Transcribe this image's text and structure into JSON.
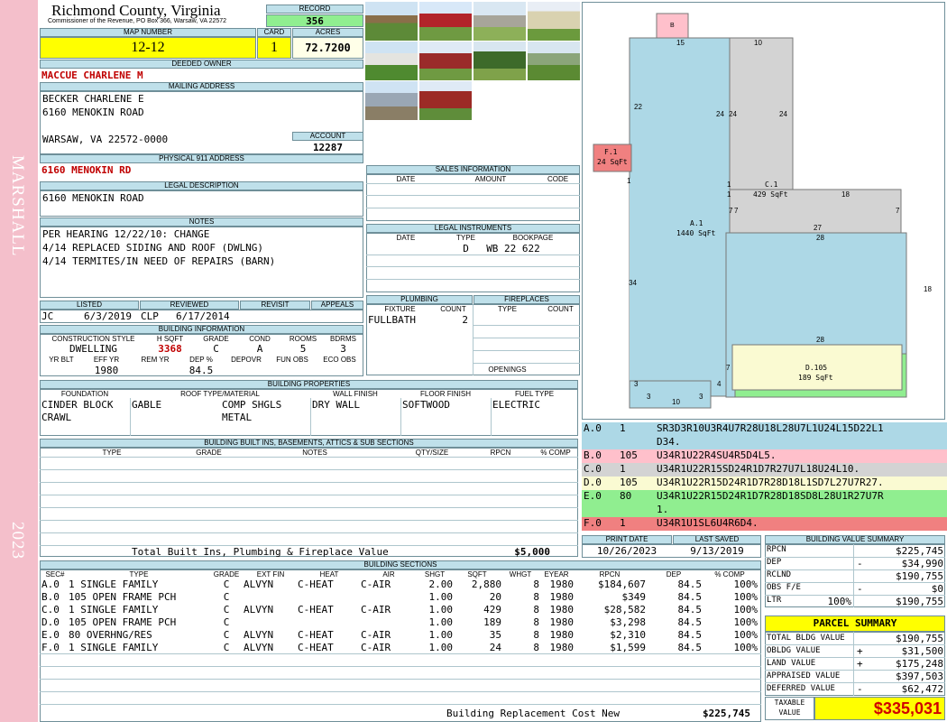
{
  "side": {
    "district": "MARSHALL",
    "year": "2023"
  },
  "header": {
    "county": "Richmond County, Virginia",
    "commissioner": "Commissioner of the Revenue, PO Box 366, Warsaw, VA 22572",
    "record_label": "RECORD",
    "record": "356",
    "map_label": "MAP NUMBER",
    "map": "12-12",
    "card_label": "CARD",
    "card": "1",
    "acres_label": "ACRES",
    "acres": "72.7200"
  },
  "owner": {
    "deeded_label": "DEEDED OWNER",
    "deeded": "MACCUE CHARLENE M",
    "mailing_label": "MAILING ADDRESS",
    "mail1": "BECKER CHARLENE E",
    "mail2": "6160 MENOKIN ROAD",
    "mail3": "WARSAW, VA 22572-0000",
    "account_label": "ACCOUNT",
    "account": "12287",
    "physical_label": "PHYSICAL 911 ADDRESS",
    "physical": "6160 MENOKIN RD",
    "legal_label": "LEGAL DESCRIPTION",
    "legal": "6160 MENOKIN ROAD",
    "notes_label": "NOTES",
    "notes1": "PER HEARING 12/22/10: CHANGE",
    "notes2": "4/14 REPLACED SIDING AND ROOF (DWLNG)",
    "notes3": "4/14 TERMITES/IN NEED OF REPAIRS (BARN)"
  },
  "review": {
    "listed_label": "LISTED",
    "reviewed_label": "REVIEWED",
    "revisit_label": "REVISIT",
    "appeals_label": "APPEALS",
    "listed_by": "JC",
    "listed_date": "6/3/2019",
    "reviewed_by": "CLP",
    "reviewed_date": "6/17/2014"
  },
  "building_info": {
    "title": "BUILDING INFORMATION",
    "h_style": "CONSTRUCTION STYLE",
    "h_sqft": "H SQFT",
    "h_grade": "GRADE",
    "h_cond": "COND",
    "h_rooms": "ROOMS",
    "h_bdrms": "BDRMS",
    "style": "DWELLING",
    "sqft": "3368",
    "grade": "C",
    "cond": "A",
    "rooms": "5",
    "bdrms": "3",
    "h_yrblt": "YR BLT",
    "h_effyr": "EFF YR",
    "h_remyr": "REM YR",
    "h_dep": "DEP %",
    "h_depovr": "DEPOVR",
    "h_funobs": "FUN OBS",
    "h_ecoobs": "ECO OBS",
    "effyr": "1980",
    "dep": "84.5"
  },
  "sales": {
    "title": "SALES INFORMATION",
    "h_date": "DATE",
    "h_amount": "AMOUNT",
    "h_code": "CODE"
  },
  "legal_instr": {
    "title": "LEGAL INSTRUMENTS",
    "h_date": "DATE",
    "h_type": "TYPE",
    "h_book": "BOOKPAGE",
    "type": "D",
    "book": "WB 22 622"
  },
  "plumbing": {
    "title": "PLUMBING",
    "h_fixture": "FIXTURE",
    "h_count": "COUNT",
    "fixture": "FULLBATH",
    "count": "2"
  },
  "fireplaces": {
    "title": "FIREPLACES",
    "h_type": "TYPE",
    "h_count": "COUNT",
    "openings": "OPENINGS"
  },
  "properties": {
    "title": "BUILDING PROPERTIES",
    "h_foundation": "FOUNDATION",
    "h_roof": "ROOF TYPE/MATERIAL",
    "h_wall": "WALL FINISH",
    "h_floor": "FLOOR FINISH",
    "h_fuel": "FUEL TYPE",
    "foundation1": "CINDER BLOCK",
    "foundation2": "CRAWL",
    "roof_type": "GABLE",
    "roof1": "COMP SHGLS",
    "roof2": "METAL",
    "wall": "DRY WALL",
    "floor": "SOFTWOOD",
    "fuel": "ELECTRIC"
  },
  "builtins": {
    "title": "BUILDING BUILT INS, BASEMENTS, ATTICS & SUB SECTIONS",
    "h_type": "TYPE",
    "h_grade": "GRADE",
    "h_notes": "NOTES",
    "h_qty": "QTY/SIZE",
    "h_rpcn": "RPCN",
    "h_comp": "% COMP",
    "total_label": "Total Built Ins, Plumbing & Fireplace Value",
    "total": "$5,000"
  },
  "sketch": {
    "b": "B",
    "f1": "F.1",
    "f1s": "24 SqFt",
    "c1": "C.1",
    "c1s": "429 SqFt",
    "a1": "A.1",
    "a1s": "1440 SqFt",
    "d105": "D.105",
    "d105s": "189 SqFt",
    "n15": "15",
    "n10": "10",
    "n22": "22",
    "n24a": "24",
    "n24b": "24",
    "n24c": "24",
    "n1a": "1",
    "n1b": "1",
    "n1c": "1",
    "n7a": "7",
    "n7b": "7",
    "n7c": "7",
    "n18a": "18",
    "n18b": "18",
    "n27": "27",
    "n28a": "28",
    "n28b": "28",
    "n34": "34",
    "n3a": "3",
    "n3b": "3",
    "n10b": "10",
    "n3c": "3",
    "n4": "4",
    "n7d": "7"
  },
  "segments": [
    {
      "id": "A.0",
      "n": "1",
      "path": "SR3D3R10U3R4U7R28U18L28U7L1U24L15D22L1",
      "path2": "D34.",
      "bg": "#add8e6"
    },
    {
      "id": "B.0",
      "n": "105",
      "path": "U34R1U22R4SU4R5D4L5.",
      "path2": "",
      "bg": "#ffc0cb"
    },
    {
      "id": "C.0",
      "n": "1",
      "path": "U34R1U22R15SD24R1D7R27U7L18U24L10.",
      "path2": "",
      "bg": "#d3d3d3"
    },
    {
      "id": "D.0",
      "n": "105",
      "path": "U34R1U22R15D24R1D7R28D18L1SD7L27U7R27.",
      "path2": "",
      "bg": "#fafad2"
    },
    {
      "id": "E.0",
      "n": "80",
      "path": "U34R1U22R15D24R1D7R28D18SD8L28U1R27U7R",
      "path2": "1.",
      "bg": "#90ee90"
    },
    {
      "id": "F.0",
      "n": "1",
      "path": "U34R1U1SL6U4R6D4.",
      "path2": "",
      "bg": "#f08080"
    }
  ],
  "dates": {
    "print_label": "PRINT DATE",
    "print": "10/26/2023",
    "saved_label": "LAST SAVED",
    "saved": "9/13/2019"
  },
  "value_summary": {
    "title": "BUILDING VALUE SUMMARY",
    "rpcn_l": "RPCN",
    "rpcn": "$225,745",
    "dep_l": "DEP",
    "dep_sign": "-",
    "dep": "$34,990",
    "rcnld_l": "RCLND",
    "rcnld": "$190,755",
    "obs_l": "OBS F/E",
    "obs_sign": "-",
    "obs": "$0",
    "ltr_l": "LTR",
    "ltr_pct": "100%",
    "ltr": "$190,755"
  },
  "parcel": {
    "title": "PARCEL SUMMARY",
    "bldg_l": "TOTAL BLDG VALUE",
    "bldg": "$190,755",
    "obldg_l": "OBLDG VALUE",
    "obldg_sign": "+",
    "obldg": "$31,500",
    "land_l": "LAND VALUE",
    "land_sign": "+",
    "land": "$175,248",
    "appr_l": "APPRAISED VALUE",
    "appr": "$397,503",
    "def_l": "DEFERRED VALUE",
    "def_sign": "-",
    "def": "$62,472",
    "tax_l1": "TAXABLE",
    "tax_l2": "VALUE",
    "tax": "$335,031"
  },
  "sections": {
    "title": "BUILDING SECTIONS",
    "headers": [
      "SEC#",
      "TYPE",
      "GRADE",
      "EXT FIN",
      "HEAT",
      "AIR",
      "SHGT",
      "SQFT",
      "WHGT",
      "EYEAR",
      "RPCN",
      "DEP",
      "% COMP"
    ],
    "rows": [
      [
        "A.0",
        "1 SINGLE FAMILY",
        "C",
        "ALVYN",
        "C-HEAT",
        "C-AIR",
        "2.00",
        "2,880",
        "8",
        "1980",
        "$184,607",
        "84.5",
        "100%"
      ],
      [
        "B.0",
        "105 OPEN FRAME PCH",
        "C",
        "",
        "",
        "",
        "1.00",
        "20",
        "8",
        "1980",
        "$349",
        "84.5",
        "100%"
      ],
      [
        "C.0",
        "1 SINGLE FAMILY",
        "C",
        "ALVYN",
        "C-HEAT",
        "C-AIR",
        "1.00",
        "429",
        "8",
        "1980",
        "$28,582",
        "84.5",
        "100%"
      ],
      [
        "D.0",
        "105 OPEN FRAME PCH",
        "C",
        "",
        "",
        "",
        "1.00",
        "189",
        "8",
        "1980",
        "$3,298",
        "84.5",
        "100%"
      ],
      [
        "E.0",
        "80 OVERHNG/RES",
        "C",
        "ALVYN",
        "C-HEAT",
        "C-AIR",
        "1.00",
        "35",
        "8",
        "1980",
        "$2,310",
        "84.5",
        "100%"
      ],
      [
        "F.0",
        "1 SINGLE FAMILY",
        "C",
        "ALVYN",
        "C-HEAT",
        "C-AIR",
        "1.00",
        "24",
        "8",
        "1980",
        "$1,599",
        "84.5",
        "100%"
      ]
    ],
    "total_label": "Building Replacement Cost New",
    "total": "$225,745"
  }
}
